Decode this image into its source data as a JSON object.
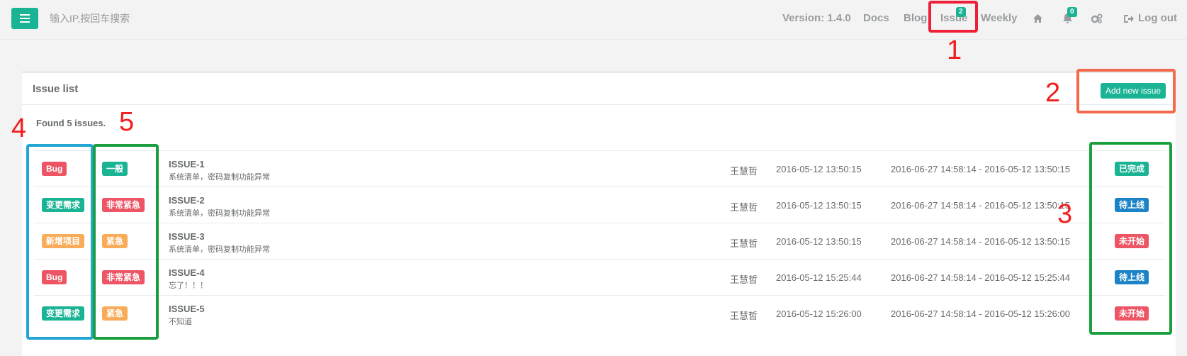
{
  "topbar": {
    "search_placeholder": "输入IP,按回车搜索",
    "version": "Version: 1.4.0",
    "docs": "Docs",
    "blog": "Blog",
    "issue": "Issue",
    "issue_badge": "2",
    "weekly": "Weekly",
    "notifications_badge": "0",
    "logout": "Log out",
    "icons": [
      "menu-icon",
      "home-icon",
      "bell-icon",
      "cogs-icon",
      "sign-out-icon"
    ]
  },
  "annotations": {
    "n1": "1",
    "n2": "2",
    "n3": "3",
    "n4": "4",
    "n5": "5"
  },
  "panel": {
    "title": "Issue list",
    "add_button": "Add new issue",
    "found": "Found 5 issues."
  },
  "issues": [
    {
      "type": "Bug",
      "type_color": "red",
      "priority": "一般",
      "priority_color": "green",
      "title": "ISSUE-1",
      "desc": "系统清单，密码复制功能异常",
      "owner": "王慧哲",
      "created": "2016-05-12 13:50:15",
      "range": "2016-06-27 14:58:14 - 2016-05-12 13:50:15",
      "status": "已完成",
      "status_color": "green"
    },
    {
      "type": "变更需求",
      "type_color": "green",
      "priority": "非常紧急",
      "priority_color": "red",
      "title": "ISSUE-2",
      "desc": "系统清单，密码复制功能异常",
      "owner": "王慧哲",
      "created": "2016-05-12 13:50:15",
      "range": "2016-06-27 14:58:14 - 2016-05-12 13:50:15",
      "status": "待上线",
      "status_color": "blue"
    },
    {
      "type": "新增项目",
      "type_color": "orange",
      "priority": "紧急",
      "priority_color": "orange",
      "title": "ISSUE-3",
      "desc": "系统清单，密码复制功能异常",
      "owner": "王慧哲",
      "created": "2016-05-12 13:50:15",
      "range": "2016-06-27 14:58:14 - 2016-05-12 13:50:15",
      "status": "未开始",
      "status_color": "red"
    },
    {
      "type": "Bug",
      "type_color": "red",
      "priority": "非常紧急",
      "priority_color": "red",
      "title": "ISSUE-4",
      "desc": "忘了！！！",
      "owner": "王慧哲",
      "created": "2016-05-12 15:25:44",
      "range": "2016-06-27 14:58:14 - 2016-05-12 15:25:44",
      "status": "待上线",
      "status_color": "blue"
    },
    {
      "type": "变更需求",
      "type_color": "green",
      "priority": "紧急",
      "priority_color": "orange",
      "title": "ISSUE-5",
      "desc": "不知道",
      "owner": "王慧哲",
      "created": "2016-05-12 15:26:00",
      "range": "2016-06-27 14:58:14 - 2016-05-12 15:26:00",
      "status": "未开始",
      "status_color": "red"
    }
  ],
  "colors": {
    "accent": "#1ab394",
    "danger": "#ed5565",
    "warning": "#f8ac59",
    "info": "#1c84c6",
    "anno_red": "#ef1f3a",
    "anno_orange": "#f26a4b",
    "anno_blue": "#23a6d5",
    "anno_green": "#1a9e3e"
  }
}
